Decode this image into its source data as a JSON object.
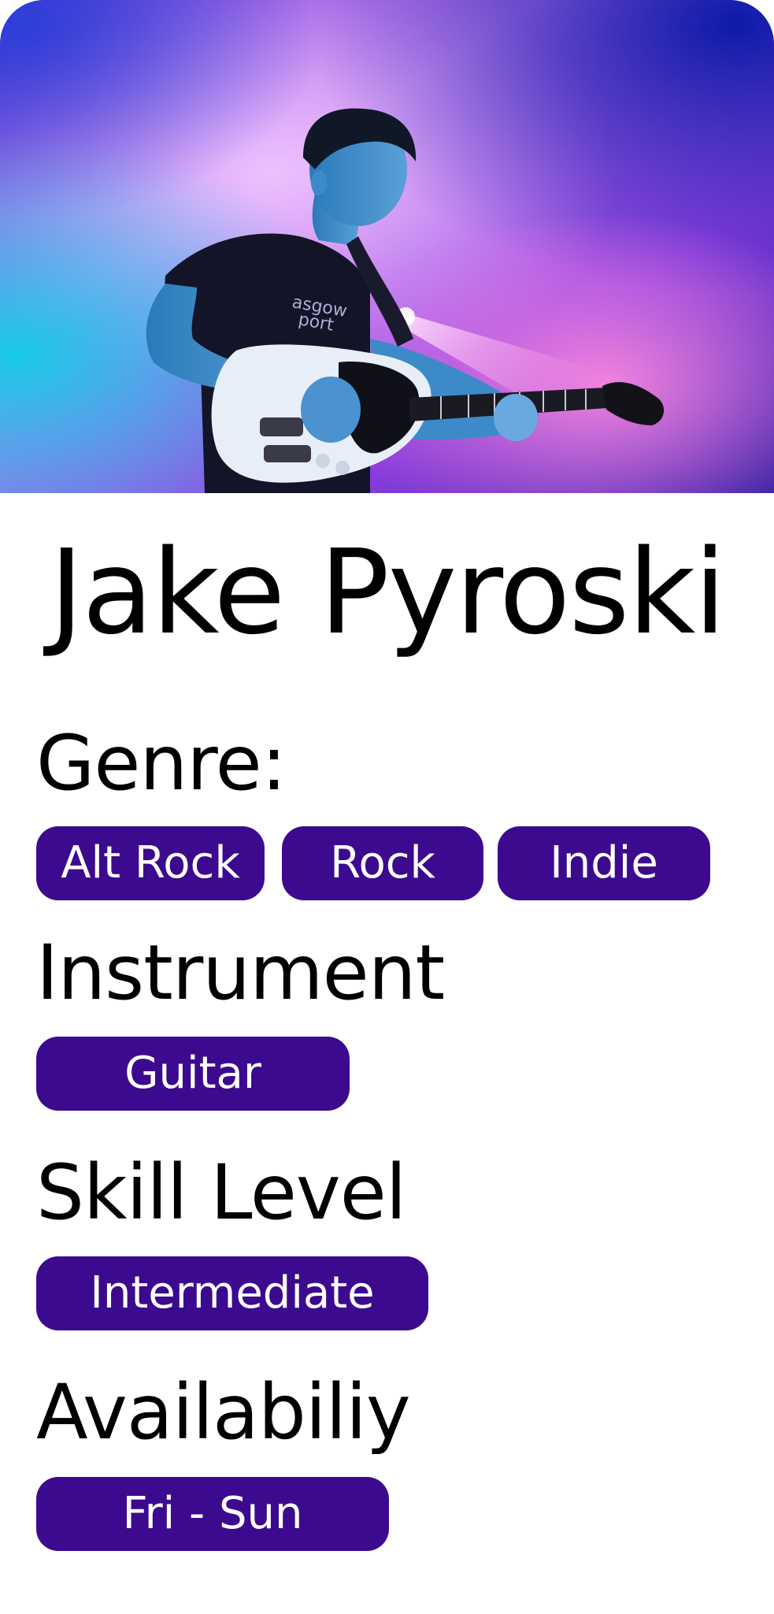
{
  "profile": {
    "name": "Jake Pyroski",
    "photo_icon": "guitarist-photo"
  },
  "sections": {
    "genre": {
      "title": "Genre:",
      "chips": [
        "Alt Rock",
        "Rock",
        "Indie"
      ]
    },
    "instrument": {
      "title": "Instrument",
      "chips": [
        "Guitar"
      ]
    },
    "skill": {
      "title": "Skill Level",
      "chips": [
        "Intermediate"
      ]
    },
    "availability": {
      "title": "Availabiliy",
      "chips": [
        "Fri - Sun"
      ]
    }
  },
  "colors": {
    "chip_background": "#3c0a8e",
    "chip_text": "#ffffff",
    "text": "#000000"
  }
}
